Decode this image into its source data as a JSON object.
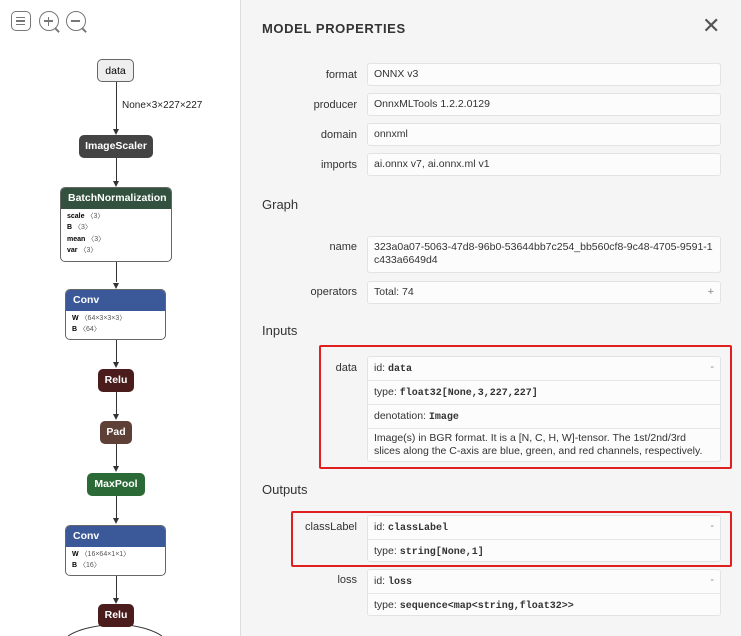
{
  "toolbar": {
    "menu_icon": "menu-icon",
    "zoom_in_icon": "zoom-in-icon",
    "zoom_out_icon": "zoom-out-icon"
  },
  "graph": {
    "input_node": "data",
    "input_shape": "None×3×227×227",
    "nodes": {
      "image_scaler": "ImageScaler",
      "batchnorm": "BatchNormalization",
      "conv1": "Conv",
      "relu1": "Relu",
      "pad": "Pad",
      "maxpool": "MaxPool",
      "conv2": "Conv",
      "relu2": "Relu"
    },
    "batchnorm_attrs": [
      {
        "name": "scale",
        "value": "〈3〉"
      },
      {
        "name": "B",
        "value": "〈3〉"
      },
      {
        "name": "mean",
        "value": "〈3〉"
      },
      {
        "name": "var",
        "value": "〈3〉"
      }
    ],
    "conv1_attrs": [
      {
        "name": "W",
        "value": "〈64×3×3×3〉"
      },
      {
        "name": "B",
        "value": "〈64〉"
      }
    ],
    "conv2_attrs": [
      {
        "name": "W",
        "value": "〈16×64×1×1〉"
      },
      {
        "name": "B",
        "value": "〈16〉"
      }
    ],
    "colors": {
      "layer": "#3b5998",
      "normalization": "#33513f",
      "activation": "#4b1c1c",
      "transform": "#5e4036",
      "pool": "#2b6a36",
      "generic": "#444444"
    }
  },
  "properties": {
    "title": "MODEL PROPERTIES",
    "close_icon": "close-icon",
    "model": [
      {
        "label": "format",
        "value": "ONNX v3"
      },
      {
        "label": "producer",
        "value": "OnnxMLTools 1.2.2.0129"
      },
      {
        "label": "domain",
        "value": "onnxml"
      },
      {
        "label": "imports",
        "value": "ai.onnx v7, ai.onnx.ml v1"
      }
    ],
    "graph_section": "Graph",
    "graph_name_label": "name",
    "graph_name_value": "323a0a07-5063-47d8-96b0-53644bb7c254_bb560cf8-9c48-4705-9591-1c433a6649d4",
    "operators_label": "operators",
    "operators_value": "Total: 74",
    "operators_toggle": "+",
    "inputs_section": "Inputs",
    "input": {
      "label": "data",
      "toggle": "-",
      "id_prefix": "id: ",
      "id_value": "data",
      "type_prefix": "type: ",
      "type_value": "float32[None,3,227,227]",
      "denotation_prefix": "denotation: ",
      "denotation_value": "Image",
      "description": "Image(s) in BGR format. It is a [N, C, H, W]-tensor. The 1st/2nd/3rd slices along the C-axis are blue, green, and red channels, respectively."
    },
    "outputs_section": "Outputs",
    "outputs": [
      {
        "label": "classLabel",
        "toggle": "-",
        "id_prefix": "id: ",
        "id_value": "classLabel",
        "type_prefix": "type: ",
        "type_value": "string[None,1]"
      },
      {
        "label": "loss",
        "toggle": "-",
        "id_prefix": "id: ",
        "id_value": "loss",
        "type_prefix": "type: ",
        "type_value": "sequence<map<string,float32>>"
      }
    ]
  }
}
